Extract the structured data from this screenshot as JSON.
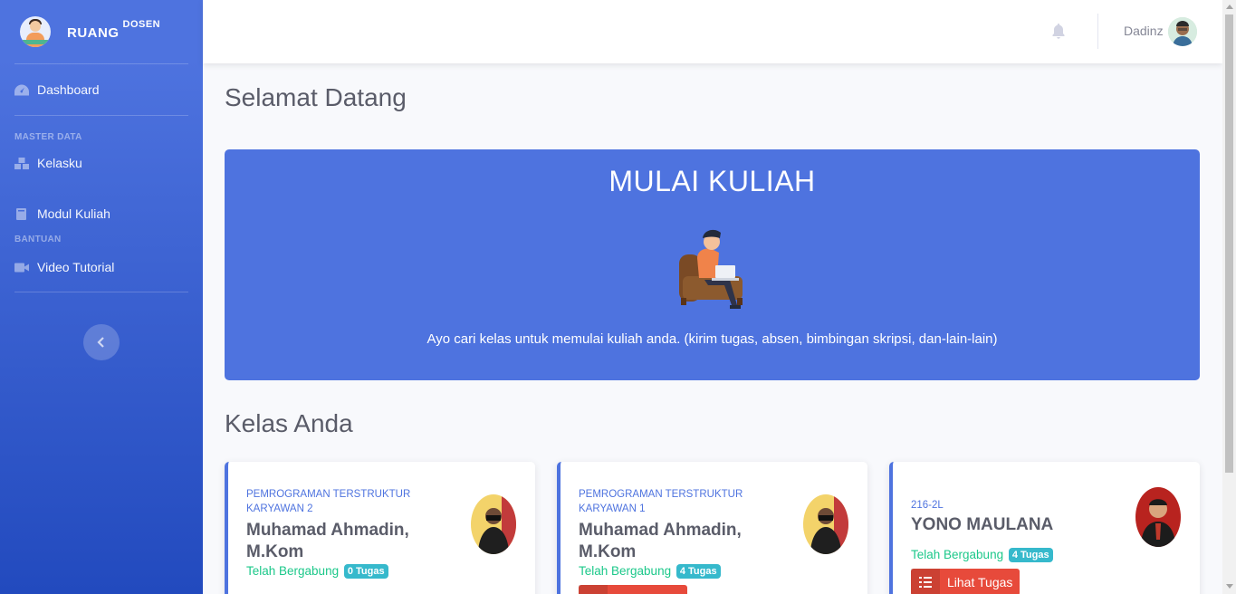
{
  "brand": {
    "name": "RUANG",
    "sup": "DOSEN"
  },
  "sidebar": {
    "dashboard": "Dashboard",
    "heading_master": "MASTER DATA",
    "kelasku": "Kelasku",
    "modul": "Modul Kuliah",
    "heading_bantuan": "BANTUAN",
    "video": "Video Tutorial"
  },
  "topbar": {
    "user_name": "Dadinz"
  },
  "page": {
    "title": "Selamat Datang"
  },
  "hero": {
    "title": "MULAI KULIAH",
    "text": "Ayo cari kelas untuk memulai kuliah anda. (kirim tugas, absen, bimbingan skripsi, dan-lain-lain)"
  },
  "section": {
    "title": "Kelas Anda"
  },
  "cards": [
    {
      "code": "PEMROGRAMAN TERSTRUKTUR KARYAWAN 2",
      "name": "Muhamad Ahmadin, M.Kom",
      "status": "Telah Bergabung",
      "tasks": "0 Tugas"
    },
    {
      "code": "PEMROGRAMAN TERSTRUKTUR KARYAWAN 1",
      "name": "Muhamad Ahmadin, M.Kom",
      "status": "Telah Bergabung",
      "tasks": "4 Tugas"
    },
    {
      "code": "216-2L",
      "name": "YONO MAULANA",
      "status": "Telah Bergabung",
      "tasks": "4 Tugas",
      "button": "Lihat Tugas"
    }
  ],
  "colors": {
    "primary": "#4e73df",
    "success": "#1cc88a",
    "info": "#36b9cc",
    "danger": "#e74a3b"
  }
}
